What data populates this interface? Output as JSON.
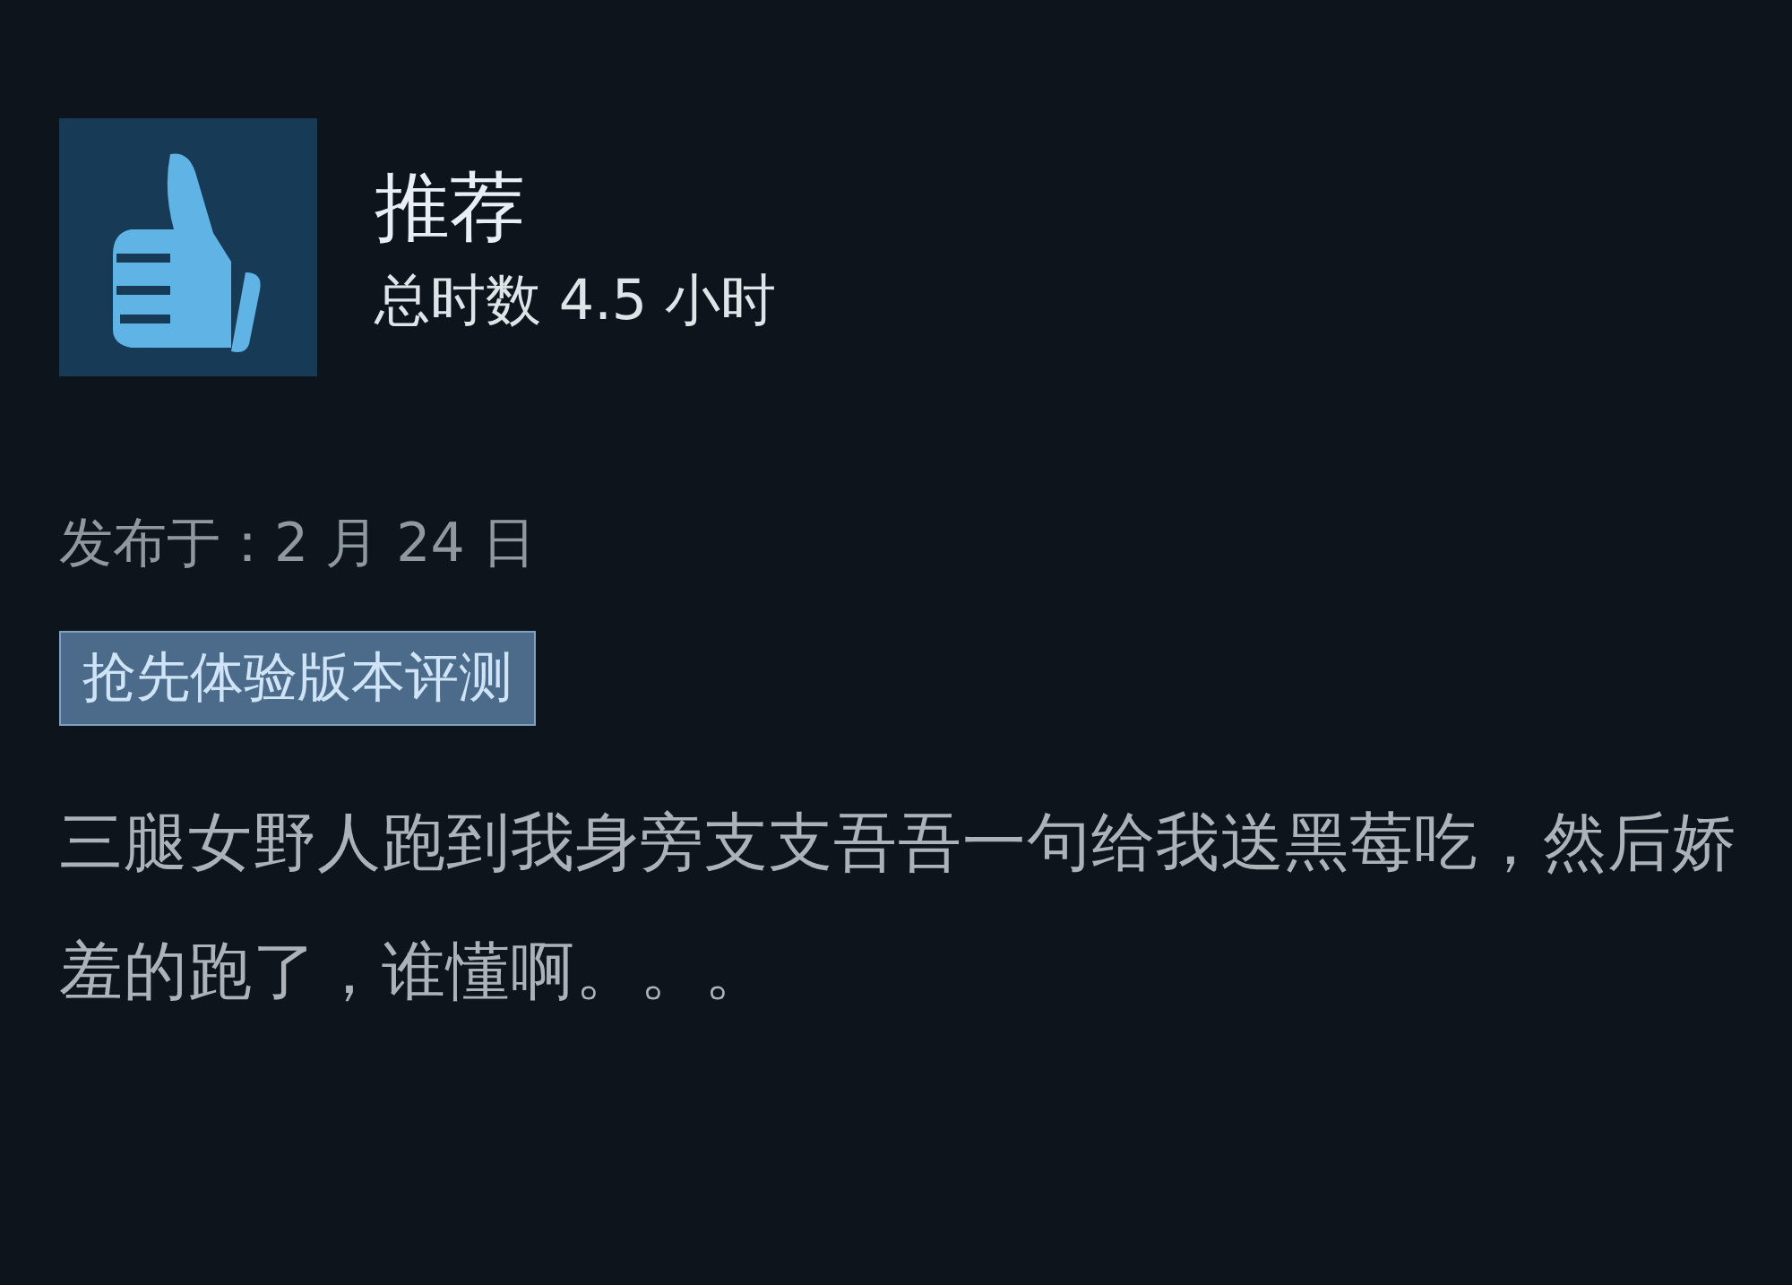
{
  "review": {
    "verdict": "推荐",
    "hours": "总时数 4.5 小时",
    "posted": "发布于：2 月 24 日",
    "tag": "抢先体验版本评测",
    "body": "三腿女野人跑到我身旁支支吾吾一句给我送黑莓吃，然后娇羞的跑了，谁懂啊。。。"
  }
}
